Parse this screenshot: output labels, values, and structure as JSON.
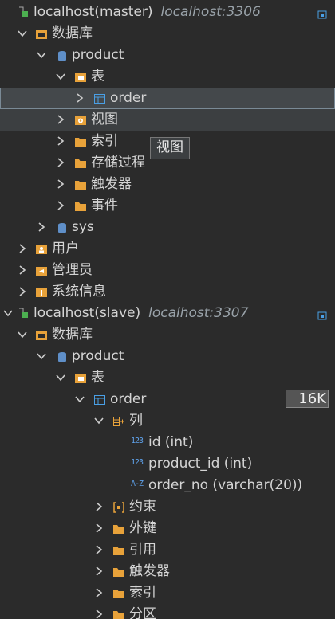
{
  "connections": [
    {
      "name": "localhost(master)",
      "host": "localhost:3306"
    },
    {
      "name": "localhost(slave)",
      "host": "localhost:3307"
    }
  ],
  "labels": {
    "databases": "数据库",
    "product": "product",
    "tables": "表",
    "order": "order",
    "views": "视图",
    "indexes": "索引",
    "procedures": "存储过程",
    "triggers": "触发器",
    "events": "事件",
    "sys": "sys",
    "users": "用户",
    "admins": "管理员",
    "sysinfo": "系统信息",
    "columns": "列",
    "col_id": "id (int)",
    "col_product": "product_id (int)",
    "col_order": "order_no (varchar(20))",
    "constraints": "约束",
    "foreign": "外键",
    "references": "引用",
    "triggers2": "触发器",
    "indexes2": "索引",
    "partitions": "分区",
    "tooltip": "视图",
    "badge": "16K"
  },
  "colors": {
    "accent": "#e8a23a",
    "tableBlue": "#4aa0e6",
    "db": "#5f8fc8"
  }
}
